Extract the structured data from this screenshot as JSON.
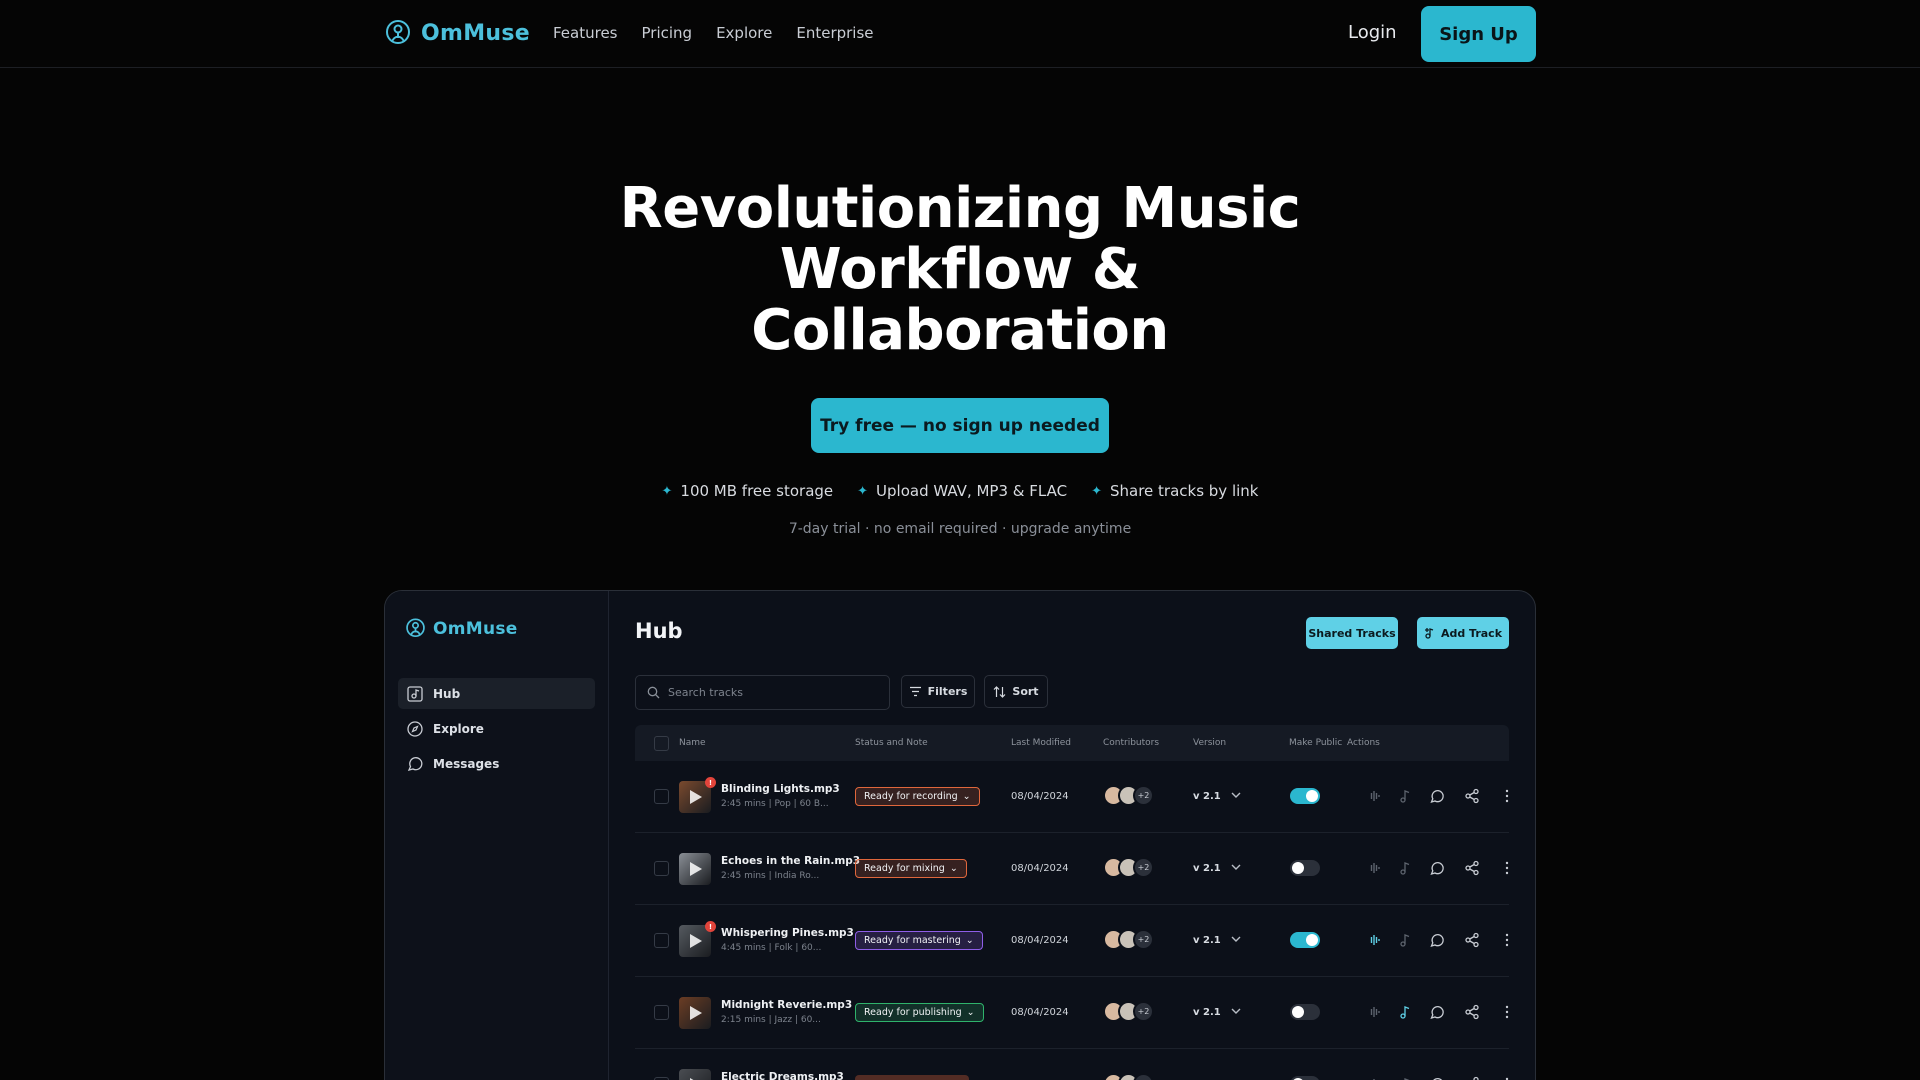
{
  "nav": {
    "brand": "OmMuse",
    "links": [
      "Features",
      "Pricing",
      "Explore",
      "Enterprise"
    ],
    "login": "Login",
    "signup": "Sign Up"
  },
  "hero": {
    "title_line1": "Revolutionizing Music",
    "title_line2": "Workflow &",
    "title_line3": "Collaboration",
    "cta": "Try free — no sign up needed",
    "features": [
      "100 MB free storage",
      "Upload WAV, MP3 & FLAC",
      "Share tracks by link"
    ],
    "note": "7-day trial · no email required · upgrade anytime"
  },
  "app": {
    "brand": "OmMuse",
    "sidebar": [
      {
        "label": "Hub",
        "icon": "hub-icon",
        "active": true
      },
      {
        "label": "Explore",
        "icon": "compass-icon",
        "active": false
      },
      {
        "label": "Messages",
        "icon": "chat-icon",
        "active": false
      }
    ],
    "title": "Hub",
    "shared_tracks": "Shared Tracks",
    "add_track": "Add Track",
    "search_placeholder": "Search tracks",
    "filters": "Filters",
    "sort": "Sort",
    "columns": [
      "Name",
      "Status and Note",
      "Last Modified",
      "Contributors",
      "Version",
      "Make Public",
      "Actions"
    ],
    "rows": [
      {
        "name": "Blinding Lights.mp3",
        "meta": "2:45 mins | Pop | 60 B...",
        "status": "Ready for recording",
        "status_color": "#e0673c",
        "date": "08/04/2024",
        "more": "+2",
        "version": "v 2.1",
        "public": true,
        "notif": "!",
        "thumb": "#7a4a2e"
      },
      {
        "name": "Echoes in the Rain.mp3",
        "meta": "2:45 mins | India Ro...",
        "status": "Ready for mixing",
        "status_color": "#e0673c",
        "date": "08/04/2024",
        "more": "+2",
        "version": "v 2.1",
        "public": false,
        "notif": "",
        "thumb": "#8a8f96"
      },
      {
        "name": "Whispering Pines.mp3",
        "meta": "4:45 mins | Folk | 60...",
        "status": "Ready for mastering",
        "status_color": "#8f5ee8",
        "date": "08/04/2024",
        "more": "+2",
        "version": "v 2.1",
        "public": true,
        "notif": "!",
        "thumb": "#555a60"
      },
      {
        "name": "Midnight Reverie.mp3",
        "meta": "2:15 mins | Jazz | 60...",
        "status": "Ready for publishing",
        "status_color": "#2fb36b",
        "date": "08/04/2024",
        "more": "+2",
        "version": "v 2.1",
        "public": false,
        "notif": "",
        "thumb": "#6b3d24"
      },
      {
        "name": "Electric Dreams.mp3",
        "meta": "",
        "status": "",
        "status_color": "#e0673c",
        "date": "",
        "more": "",
        "version": "",
        "public": false,
        "notif": "",
        "thumb": "#4a4d52"
      }
    ]
  },
  "colors": {
    "accent": "#2bb7cf",
    "accent_light": "#5fd0e6",
    "bg": "#050505"
  }
}
